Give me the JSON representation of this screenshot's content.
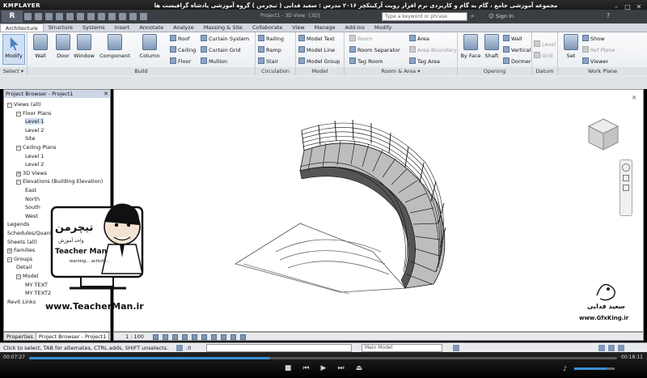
{
  "player": {
    "logo": "KMPLAYER",
    "title": "مجموعه آموزشی جامع ، گام به گام و کاربردی نرم افزار رویت آرکیتکچر ۲۰۱۶  مدرس : سعید فدایی ( تیچرمن ) گروه آموزشی پادشاه گرافیست ها",
    "time_current": "00:07:27",
    "time_total": "00:18:11",
    "progress": 0.41,
    "volume": 0.8
  },
  "revit": {
    "app_menu": "R",
    "doc_title": "Project1 - 3D View: {3D}",
    "search_placeholder": "Type a keyword or phrase",
    "sign_in": "Sign In"
  },
  "tabs": [
    "Architecture",
    "Structure",
    "Systems",
    "Insert",
    "Annotate",
    "Analyze",
    "Massing & Site",
    "Collaborate",
    "View",
    "Manage",
    "Add-Ins",
    "Modify"
  ],
  "ribbon": {
    "select": {
      "modify": "Modify",
      "label": "Select ▾"
    },
    "build": {
      "label": "Build",
      "big": [
        "Wall",
        "Door",
        "Window",
        "Component",
        "Column"
      ],
      "small": [
        "Roof",
        "Ceiling",
        "Floor",
        "Curtain System",
        "Curtain Grid",
        "Mullion"
      ]
    },
    "circulation": {
      "label": "Circulation",
      "items": [
        "Railing",
        "Ramp",
        "Stair"
      ]
    },
    "model": {
      "label": "Model",
      "items": [
        "Model Text",
        "Model Line",
        "Model Group"
      ]
    },
    "room_area": {
      "label": "Room & Area ▾",
      "items": [
        "Room",
        "Room Separator",
        "Tag Room",
        "Area",
        "Area Boundary",
        "Tag Area"
      ]
    },
    "opening": {
      "label": "Opening",
      "items": [
        "By Face",
        "Shaft",
        "Wall",
        "Vertical",
        "Dormer"
      ]
    },
    "datum": {
      "label": "Datum",
      "items": [
        "Level",
        "Grid"
      ]
    },
    "work_plane": {
      "label": "Work Plane",
      "items": [
        "Set",
        "Show",
        "Ref Plane",
        "Viewer"
      ]
    }
  },
  "browser": {
    "title": "Project Browser - Project1",
    "close": "✕",
    "tree": [
      {
        "label": "Views (all)",
        "exp": "−"
      },
      {
        "label": "Floor Plans",
        "exp": "−"
      },
      {
        "label": "Level 1",
        "exp": ""
      },
      {
        "label": "Level 2",
        "exp": ""
      },
      {
        "label": "Site",
        "exp": ""
      },
      {
        "label": "Ceiling Plans",
        "exp": "−"
      },
      {
        "label": "Level 1",
        "exp": ""
      },
      {
        "label": "Level 2",
        "exp": ""
      },
      {
        "label": "3D Views",
        "exp": "+"
      },
      {
        "label": "Elevations (Building Elevation)",
        "exp": "−"
      },
      {
        "label": "East",
        "exp": ""
      },
      {
        "label": "North",
        "exp": ""
      },
      {
        "label": "South",
        "exp": ""
      },
      {
        "label": "West",
        "exp": ""
      },
      {
        "label": "Legends",
        "exp": ""
      },
      {
        "label": "Schedules/Quantities",
        "exp": ""
      },
      {
        "label": "Sheets (all)",
        "exp": ""
      },
      {
        "label": "Families",
        "exp": "+"
      },
      {
        "label": "Groups",
        "exp": "−"
      },
      {
        "label": "Detail",
        "exp": ""
      },
      {
        "label": "Model",
        "exp": "−"
      },
      {
        "label": "MY TEXT",
        "exp": ""
      },
      {
        "label": "MY TEXT2",
        "exp": ""
      },
      {
        "label": "Revit Links",
        "exp": ""
      }
    ],
    "tab_properties": "Properties",
    "tab_browser": "Project Browser - Project1"
  },
  "viewbar": {
    "scale": "1 : 100"
  },
  "status": {
    "text": "Click to select, TAB for alternates, CTRL adds, SHIFT unselects.",
    "zero": ":0",
    "model": "Main Model"
  },
  "watermark_left": {
    "brand": "تیچرمن",
    "sub": "واحد آموزش",
    "name": "Teacher Man",
    "tag": "learning... activity...",
    "url": "www.TeacherMan.ir"
  },
  "watermark_right": {
    "name": "سعید فدایی",
    "url": "www.GfxKing.ir"
  },
  "colors": {
    "accent": "#3b8fd6",
    "ribbon_bg": "#eef1f4",
    "title_bg": "#3a3d42"
  }
}
